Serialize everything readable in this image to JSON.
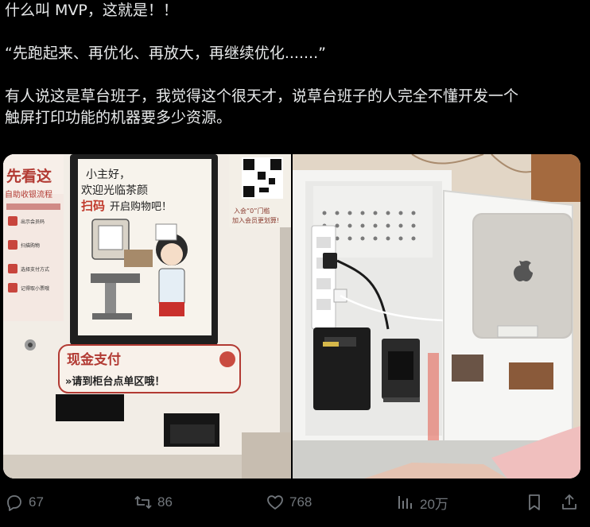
{
  "post": {
    "lines": [
      "什么叫 MVP，这就是！！",
      "",
      "“先跑起来、再优化、再放大，再继续优化.......”",
      "",
      "有人说这是草台班子，我觉得这个很天才，说草台班子的人完全不懂开发一个",
      "触屏打印功能的机器要多少资源。"
    ]
  },
  "media": {
    "left_photo": {
      "screen_line1": "小主好，",
      "screen_line2": "欢迎光临茶颜",
      "screen_line3a": "扫码",
      "screen_line3b": "开启购物吧！",
      "poster_line1": "先看这",
      "poster_line2": "自助收银流程",
      "poster_step1": "出示会员码",
      "poster_step2": "扫描购物",
      "poster_step3": "选择支付方式",
      "poster_step4": "记得取小票哦",
      "qr_line1": "入会“0”门槛",
      "qr_line2": "加入会员更划算!",
      "sign_line1": "现金支付",
      "sign_line2": "»请到柜台点单区哦！"
    }
  },
  "actions": {
    "replies": "67",
    "reposts": "86",
    "likes": "768",
    "views": "20万"
  },
  "colors": {
    "background": "#000000",
    "text": "#e7e9ea",
    "muted": "#71767b"
  }
}
